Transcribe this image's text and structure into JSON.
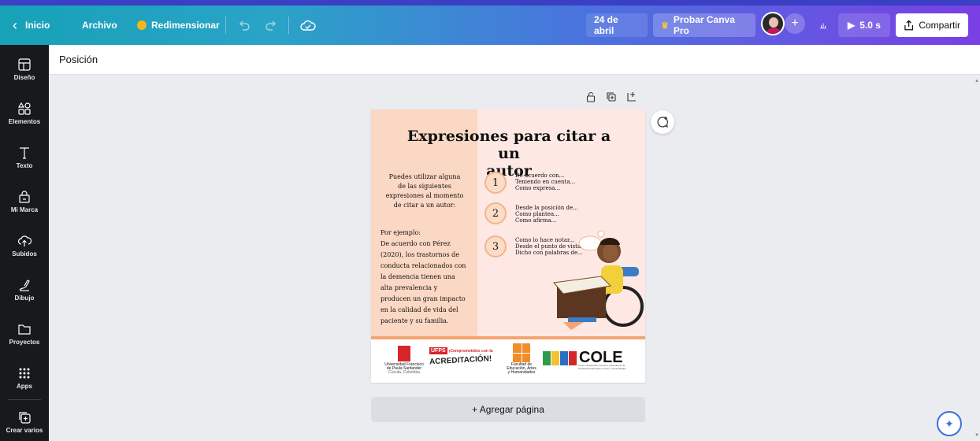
{
  "topbar": {
    "back_label": "Inicio",
    "file_label": "Archivo",
    "resize_label": "Redimensionar",
    "date_label": "24 de abril",
    "pro_label": "Probar Canva Pro",
    "duration_label": "5.0 s",
    "share_label": "Compartir"
  },
  "sidebar": {
    "items": [
      {
        "label": "Diseño",
        "icon": "layout-icon"
      },
      {
        "label": "Elementos",
        "icon": "shapes-icon"
      },
      {
        "label": "Texto",
        "icon": "text-icon"
      },
      {
        "label": "Mi Marca",
        "icon": "brand-icon"
      },
      {
        "label": "Subidos",
        "icon": "cloud-upload-icon"
      },
      {
        "label": "Dibujo",
        "icon": "draw-icon"
      },
      {
        "label": "Proyectos",
        "icon": "folder-icon"
      },
      {
        "label": "Apps",
        "icon": "apps-grid-icon"
      },
      {
        "label": "Crear varios",
        "icon": "duplicate-icon"
      }
    ]
  },
  "toolbar": {
    "position_label": "Posición"
  },
  "design": {
    "title_line1": "Expresiones para citar a un",
    "title_line2": "autor",
    "intro_lines": [
      "Puedes utilizar alguna",
      "de las siguientes",
      "expresiones al momento",
      "de citar a un autor:"
    ],
    "example_lines": [
      "Por ejemplo:",
      "De acuerdo con Pérez",
      "(2020), los trastornos de",
      "conducta relacionados con",
      "la demencia tienen una",
      "alta prevalencia y",
      "producen un gran impacto",
      "en la calidad de vida del",
      "paciente y su familia."
    ],
    "groups": [
      {
        "number": "1",
        "phrases": [
          "De acuerdo con...",
          "Teniendo en cuenta...",
          "Como expresa..."
        ]
      },
      {
        "number": "2",
        "phrases": [
          "Desde la posición de...",
          "Como plantea...",
          "Como afirma..."
        ]
      },
      {
        "number": "3",
        "phrases": [
          "Como lo hace notar...",
          "Desde el punto de vista de...",
          "Dicho con palabras de..."
        ]
      }
    ],
    "logos": {
      "university_lines": [
        "Universidad Francisco",
        "de Paula Santander",
        "Cúcuta, Colombia"
      ],
      "ufps_badge": "UFPS",
      "ufps_slogan": "¡Comprometidos con la",
      "ufps_accreditation": "ACREDITACIÓN!",
      "faculty_lines": [
        "Facultad de",
        "Educación, Artes",
        "y Humanidades"
      ],
      "cole_name": "COLE",
      "cole_desc": [
        "Centro de Estudios Lectores y Escritos de la",
        "Facultad de Educación, Artes y Humanidades"
      ]
    }
  },
  "add_page_label": "+ Agregar página",
  "colors": {
    "sidebar_bg": "#18191b",
    "canvas_bg": "#ebecf0",
    "page_bg": "#fde8e4",
    "left_panel": "#fbd8c4",
    "accent_orange": "#f5a36f"
  }
}
